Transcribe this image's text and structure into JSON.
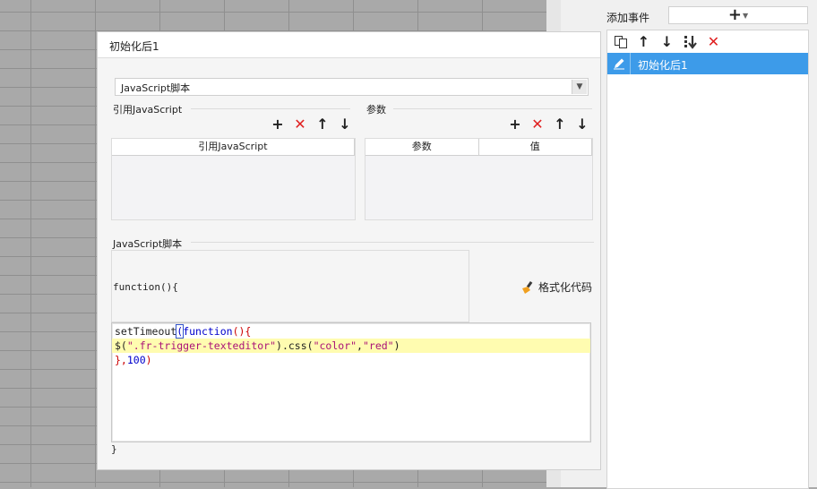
{
  "dialog": {
    "title": "初始化后1",
    "script_type": "JavaScript脚本",
    "sections": {
      "ref_js": "引用JavaScript",
      "params": "参数",
      "js_script": "JavaScript脚本"
    },
    "ref_table": {
      "header": "引用JavaScript"
    },
    "param_table": {
      "headers": [
        "参数",
        "值"
      ]
    },
    "function_open": "function(){",
    "format_button": "格式化代码",
    "code": {
      "line1_a": "setTimeout",
      "line1_paren": "(",
      "line1_kw": "function",
      "line1_b": "(){",
      "line2_a": "$(",
      "line2_str1": "\".fr-trigger-texteditor\"",
      "line2_b": ").css(",
      "line2_str2": "\"color\"",
      "line2_c": ",",
      "line2_str3": "\"red\"",
      "line2_d": ")",
      "line3_a": "},",
      "line3_num": "100",
      "line3_b": ")"
    },
    "function_close": "}"
  },
  "events_panel": {
    "label": "添加事件",
    "add_symbol": "+",
    "items": [
      "初始化后1"
    ]
  },
  "icons": {
    "add": "+",
    "delete": "✕",
    "up": "↑",
    "down": "↓"
  },
  "colors": {
    "selection": "#3d9be9",
    "delete_red": "#e02020",
    "highlight": "#fffcb0",
    "keyword": "#0000cc",
    "string": "#aa1177"
  }
}
